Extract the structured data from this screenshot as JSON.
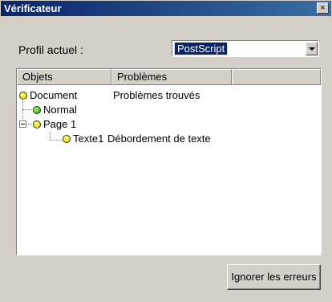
{
  "window": {
    "title": "Vérificateur",
    "close_glyph": "×"
  },
  "profile": {
    "label": "Profil actuel :",
    "selected": "PostScript"
  },
  "tree": {
    "columns": [
      "Objets",
      "Problèmes"
    ],
    "rows": [
      {
        "name": "Document",
        "problem": "Problèmes trouvés",
        "status": "warning",
        "status_color": "#e0c800"
      },
      {
        "name": "Normal",
        "problem": "",
        "status": "ok",
        "status_color": "#28a800"
      },
      {
        "name": "Page 1",
        "problem": "",
        "status": "warning",
        "status_color": "#e0c800"
      },
      {
        "name": "Texte1",
        "problem": "Débordement de texte",
        "status": "warning",
        "status_color": "#e0c800"
      }
    ]
  },
  "buttons": {
    "ignore_errors": "Ignorer les erreurs"
  }
}
